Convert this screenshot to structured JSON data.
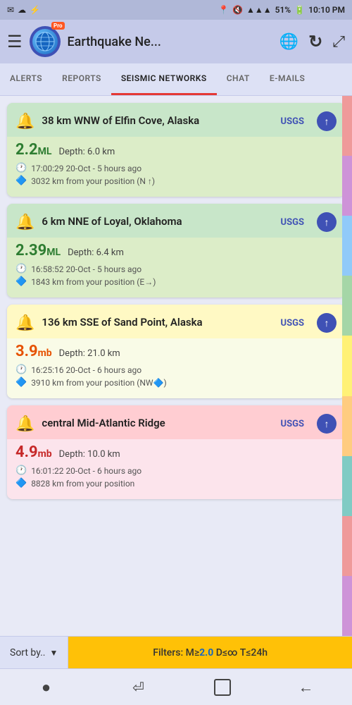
{
  "statusBar": {
    "leftIcons": [
      "✉",
      "☁",
      "⚡"
    ],
    "locationIcon": "📍",
    "muteIcon": "🔇",
    "wifiIcon": "WiFi",
    "signalText": "51%",
    "batteryIcon": "🔋",
    "time": "10:10 PM"
  },
  "appBar": {
    "title": "Earthquake Ne...",
    "menuIcon": "☰",
    "refreshIcon": "↻",
    "expandIcon": "⤢"
  },
  "tabs": [
    {
      "id": "alerts",
      "label": "ALERTS",
      "active": false
    },
    {
      "id": "reports",
      "label": "REPORTS",
      "active": false
    },
    {
      "id": "seismic",
      "label": "SEISMIC NETWORKS",
      "active": true
    },
    {
      "id": "chat",
      "label": "CHAT",
      "active": false
    },
    {
      "id": "emails",
      "label": "E-MAILS",
      "active": false
    }
  ],
  "earthquakes": [
    {
      "id": 1,
      "location": "38 km WNW of Elfin Cove, Alaska",
      "source": "USGS",
      "magnitude": "2.2",
      "magnitudeType": "ML",
      "depth": "Depth: 6.0 km",
      "time": "17:00:29 20-Oct - 5 hours ago",
      "distance": "3032 km from your position (N ↑)",
      "colorTheme": "green",
      "magColor": "green"
    },
    {
      "id": 2,
      "location": "6 km NNE of Loyal, Oklahoma",
      "source": "USGS",
      "magnitude": "2.39",
      "magnitudeType": "ML",
      "depth": "Depth: 6.4 km",
      "time": "16:58:52 20-Oct - 5 hours ago",
      "distance": "1843 km from your position (E→)",
      "colorTheme": "green",
      "magColor": "green"
    },
    {
      "id": 3,
      "location": "136 km SSE of Sand Point, Alaska",
      "source": "USGS",
      "magnitude": "3.9",
      "magnitudeType": "mb",
      "depth": "Depth: 21.0 km",
      "time": "16:25:16 20-Oct - 6 hours ago",
      "distance": "3910 km from your position (NW🔷)",
      "colorTheme": "yellow",
      "magColor": "orange"
    },
    {
      "id": 4,
      "location": "central Mid-Atlantic Ridge",
      "source": "USGS",
      "magnitude": "4.9",
      "magnitudeType": "mb",
      "depth": "Depth: 10.0 km",
      "time": "16:01:22 20-Oct - 6 hours ago",
      "distance": "8828 km from your position",
      "colorTheme": "red",
      "magColor": "red"
    }
  ],
  "filterBar": {
    "sortLabel": "Sort by..",
    "filterText": "Filters: M≥",
    "filterMag": "2.0",
    "filterDist": "D≤∞",
    "filterTime": "T≤24h"
  },
  "navBar": {
    "dotIcon": "●",
    "returnIcon": "⏎",
    "squareIcon": "□",
    "backIcon": "←"
  }
}
